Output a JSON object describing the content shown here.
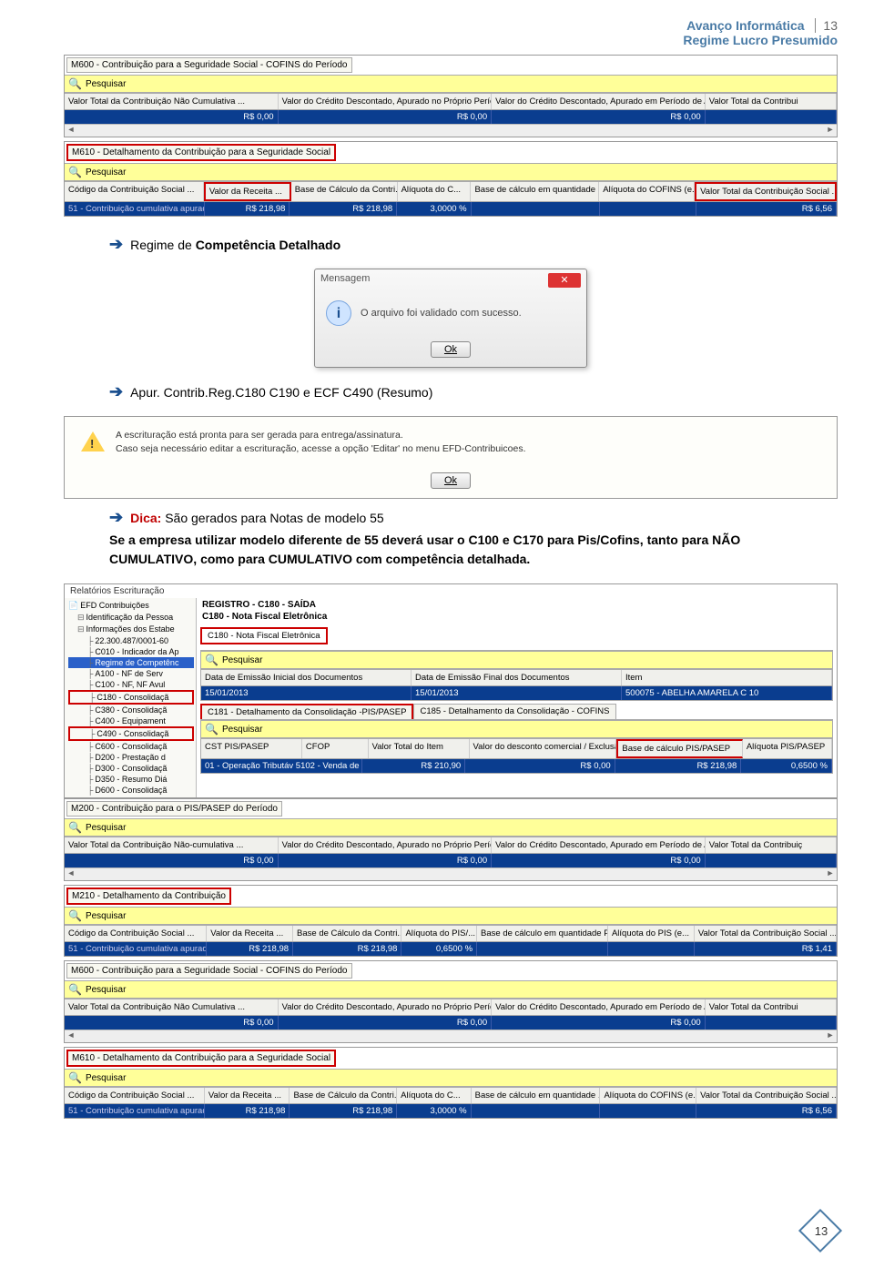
{
  "header": {
    "company": "Avanço Informática",
    "subtitle": "Regime Lucro Presumido",
    "page_number": "13"
  },
  "sections": {
    "m600_title": "M600 - Contribuição para a Seguridade Social - COFINS do Período",
    "pesquisar": "Pesquisar",
    "m600_headers": [
      "Valor Total da Contribuição Não Cumulativa ...",
      "Valor do Crédito Descontado, Apurado no Próprio Período da Es...",
      "Valor do Crédito Descontado, Apurado em Período de Apuraç...",
      "Valor Total da Contribui"
    ],
    "m600_values": [
      "R$ 0,00",
      "R$ 0,00",
      "R$ 0,00",
      ""
    ],
    "m610_title": "M610 - Detalhamento da Contribuição para a Seguridade Social",
    "m610_headers": [
      "Código da Contribuição Social ...",
      "Valor da Receita ...",
      "Base de Cálculo da Contri...",
      "Alíquota do C...",
      "Base de cálculo em quantidade ...",
      "Alíquota do COFINS (e...",
      "Valor Total da Contribuição Social ..."
    ],
    "m610_row_label": "51 - Contribuição cumulativa apurad...",
    "m610_values": [
      "R$ 218,98",
      "R$ 218,98",
      "3,0000 %",
      "",
      "",
      "R$ 6,56"
    ]
  },
  "body1": {
    "line1": "Regime de Competência Detalhado",
    "line1_bold": "Competência Detalhado"
  },
  "dialog": {
    "title": "Mensagem",
    "msg": "O arquivo foi validado com sucesso.",
    "ok": "Ok"
  },
  "body2": {
    "line": "Apur. Contrib.Reg.C180 C190 e ECF C490 (Resumo)"
  },
  "notice": {
    "p1": "A escrituração está pronta para ser gerada para entrega/assinatura.",
    "p2": "Caso seja necessário editar a escrituração, acesse a opção 'Editar' no menu EFD-Contribuicoes.",
    "ok": "Ok"
  },
  "tip": {
    "label": "Dica:",
    "line": "São gerados para Notas de modelo 55",
    "para": "Se a empresa utilizar modelo diferente de 55 deverá usar o C100 e C170 para Pis/Cofins, tanto para NÃO CUMULATIVO, como para CUMULATIVO com competência detalhada."
  },
  "app": {
    "menu": "Relatórios   Escrituração",
    "tree": [
      {
        "t": "EFD Contribuições",
        "cls": ""
      },
      {
        "t": "Identificação da Pessoa",
        "cls": "indent1"
      },
      {
        "t": "Informações dos Estabe",
        "cls": "indent1"
      },
      {
        "t": "22.300.487/0001-60",
        "cls": "indent2"
      },
      {
        "t": "C010 - Indicador da Ap",
        "cls": "indent2"
      },
      {
        "t": "Regime de Competênc",
        "cls": "indent2 selected"
      },
      {
        "t": "A100 - NF de Serv",
        "cls": "indent2"
      },
      {
        "t": "C100 - NF, NF Avul",
        "cls": "indent2"
      },
      {
        "t": "C180 - Consolidaçã",
        "cls": "indent2 tree-red"
      },
      {
        "t": "C380 - Consolidaçã",
        "cls": "indent2"
      },
      {
        "t": "C400 - Equipament",
        "cls": "indent2"
      },
      {
        "t": "C490 - Consolidaçã",
        "cls": "indent2 tree-red"
      },
      {
        "t": "C600 - Consolidaçã",
        "cls": "indent2"
      },
      {
        "t": "D200 - Prestação d",
        "cls": "indent2"
      },
      {
        "t": "D300 - Consolidaçã",
        "cls": "indent2"
      },
      {
        "t": "D350 - Resumo Diá",
        "cls": "indent2"
      },
      {
        "t": "D600 - Consolidaçã",
        "cls": "indent2"
      }
    ],
    "reg_title": "REGISTRO - C180 - SAÍDA",
    "reg_sub": "C180 - Nota Fiscal Eletrônica",
    "c180_chip": "C180 - Nota Fiscal Eletrônica",
    "c180_headers": [
      "Data de Emissão Inicial dos Documentos",
      "Data de Emissão Final dos Documentos",
      "Item"
    ],
    "c180_values": [
      "15/01/2013",
      "15/01/2013",
      "500075 - ABELHA AMARELA C 10"
    ],
    "tab1": "C181 - Detalhamento da Consolidação -PIS/PASEP",
    "tab2": "C185 - Detalhamento da Consolidação - COFINS",
    "c181_headers": [
      "CST PIS/PASEP",
      "CFOP",
      "Valor Total do Item",
      "Valor do desconto comercial / Exclusão",
      "Base de cálculo PIS/PASEP",
      "Alíquota PIS/PASEP"
    ],
    "c181_row_label": "01 - Operação Tributáv  5102 - Venda de merc",
    "c181_values": [
      "",
      "R$ 210,90",
      "R$ 0,00",
      "R$ 218,98",
      "0,6500 %"
    ]
  },
  "m200_title": "M200 - Contribuição para o PIS/PASEP do Período",
  "m200_headers": [
    "Valor Total da Contribuição Não-cumulativa ...",
    "Valor do Crédito Descontado, Apurado no Próprio Período da Es...",
    "Valor do Crédito Descontado, Apurado em Período de Apuraç...",
    "Valor Total da Contribuiç"
  ],
  "m200_values": [
    "R$ 0,00",
    "R$ 0,00",
    "R$ 0,00",
    ""
  ],
  "m210_title": "M210 - Detalhamento da Contribuição",
  "m210_headers": [
    "Código da Contribuição Social ...",
    "Valor da Receita ...",
    "Base de Cálculo da Contri...",
    "Alíquota do PIS/...",
    "Base de cálculo em quantidade PIS...",
    "Alíquota do PIS (e...",
    "Valor Total da Contribuição Social ..."
  ],
  "m210_row_label": "51 - Contribuição cumulativa apurad...",
  "m210_values": [
    "R$ 218,98",
    "R$ 218,98",
    "0,6500 %",
    "",
    "",
    "R$ 1,41"
  ],
  "m600b_title": "M600 - Contribuição para a Seguridade Social - COFINS do Período",
  "m610b_title": "M610 - Detalhamento da Contribuição para a Seguridade Social",
  "m610b_headers": [
    "Código da Contribuição Social ...",
    "Valor da Receita ...",
    "Base de Cálculo da Contri...",
    "Alíquota do C...",
    "Base de cálculo em quantidade ...",
    "Alíquota do COFINS (e...",
    "Valor Total da Contribuição Social ..."
  ],
  "m610b_row_label": "51 - Contribuição cumulativa apurad...",
  "m610b_values": [
    "R$ 218,98",
    "R$ 218,98",
    "3,0000 %",
    "",
    "",
    "R$ 6,56"
  ],
  "footer_page": "13"
}
